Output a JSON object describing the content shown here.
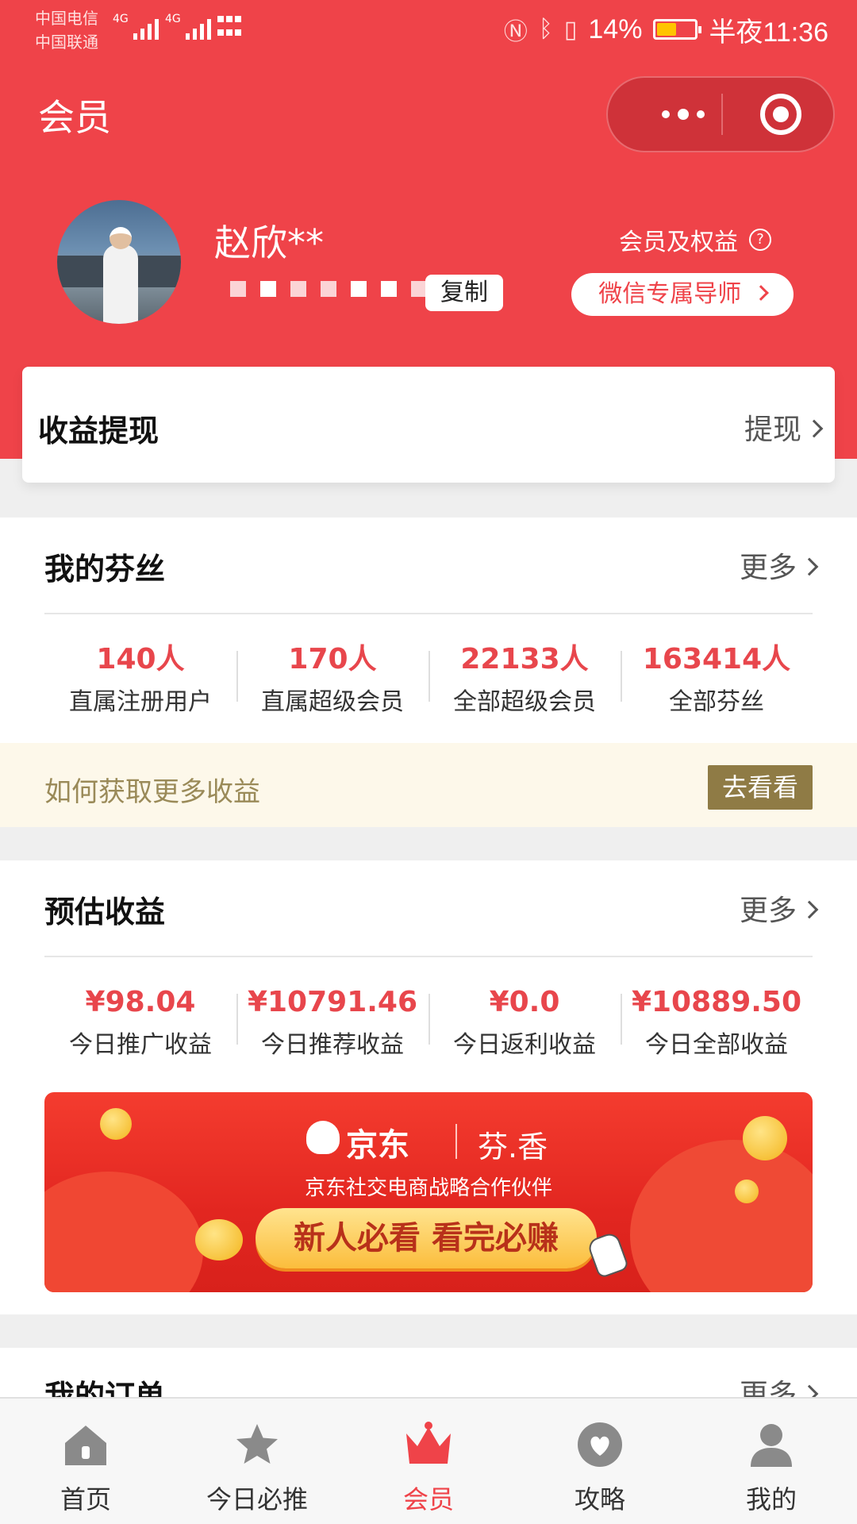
{
  "status_bar": {
    "carrier1": "中国电信",
    "carrier2": "中国联通",
    "net1": "4G",
    "net2": "4G",
    "battery": "14%",
    "time": "半夜11:36"
  },
  "nav": {
    "title": "会员"
  },
  "profile": {
    "name": "赵欣**",
    "copy_label": "复制",
    "rights_label": "会员及权益",
    "mentor_label": "微信专属导师"
  },
  "withdraw": {
    "title": "收益提现",
    "action": "提现"
  },
  "fans": {
    "title": "我的芬丝",
    "more": "更多",
    "stats": [
      {
        "value": "140人",
        "label": "直属注册用户"
      },
      {
        "value": "170人",
        "label": "直属超级会员"
      },
      {
        "value": "22133人",
        "label": "全部超级会员"
      },
      {
        "value": "163414人",
        "label": "全部芬丝"
      }
    ],
    "tip": "如何获取更多收益",
    "tip_button": "去看看"
  },
  "earnings": {
    "title": "预估收益",
    "more": "更多",
    "stats": [
      {
        "value": "¥98.04",
        "label": "今日推广收益"
      },
      {
        "value": "¥10791.46",
        "label": "今日推荐收益"
      },
      {
        "value": "¥0.0",
        "label": "今日返利收益"
      },
      {
        "value": "¥10889.50",
        "label": "今日全部收益"
      }
    ]
  },
  "banner": {
    "brand": "京东",
    "partner": "芬.香",
    "subtitle": "京东社交电商战略合作伙伴",
    "cta": "新人必看  看完必赚"
  },
  "orders": {
    "title": "我的订单",
    "more": "更多"
  },
  "tabbar": {
    "items": [
      {
        "label": "首页",
        "icon": "home-icon"
      },
      {
        "label": "今日必推",
        "icon": "star-icon"
      },
      {
        "label": "会员",
        "icon": "crown-icon"
      },
      {
        "label": "攻略",
        "icon": "heart-icon"
      },
      {
        "label": "我的",
        "icon": "person-icon"
      }
    ],
    "active_index": 2
  },
  "colors": {
    "brand_red": "#ef4349",
    "value_red": "#e8464c",
    "tip_bg": "#fdf8ea",
    "tip_button": "#8f7b45",
    "icon_gray": "#8a8a8a"
  }
}
